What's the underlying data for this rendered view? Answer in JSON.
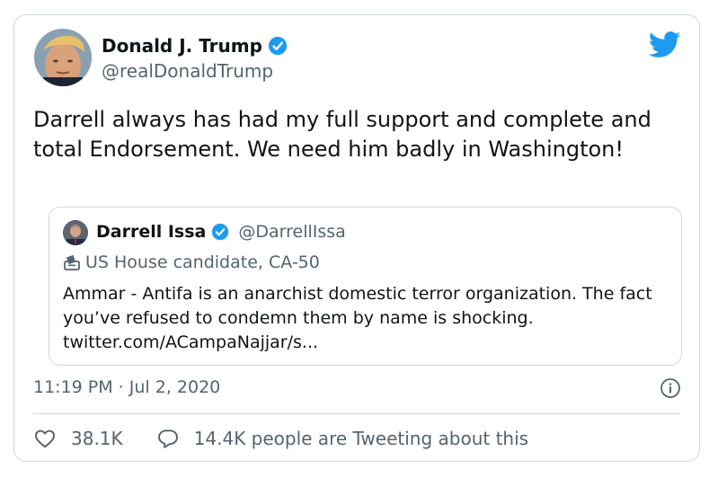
{
  "author": {
    "name": "Donald J. Trump",
    "handle": "@realDonaldTrump"
  },
  "tweet": {
    "text": "Darrell always has had my full support and complete and total Endorsement. We need him badly in Washington!",
    "timestamp": "11:19 PM · Jul 2, 2020"
  },
  "quoted": {
    "name": "Darrell Issa",
    "handle": "@DarrellIssa",
    "subtitle": "US House candidate, CA-50",
    "text": "Ammar - Antifa is an anarchist domestic terror organization. The fact you’ve refused to condemn them by name is shocking. twitter.com/ACampaNajjar/s..."
  },
  "actions": {
    "likes": "38.1K",
    "replies": "14.4K people are Tweeting about this"
  },
  "colors": {
    "verified": "#1d9bf0",
    "bird": "#1d9bf0",
    "secondary_text": "#536471",
    "border": "#cfd9de"
  },
  "icons": [
    "avatar",
    "verified-badge-icon",
    "twitter-bird-icon",
    "ballot-box-icon",
    "info-icon",
    "heart-icon",
    "reply-icon"
  ]
}
